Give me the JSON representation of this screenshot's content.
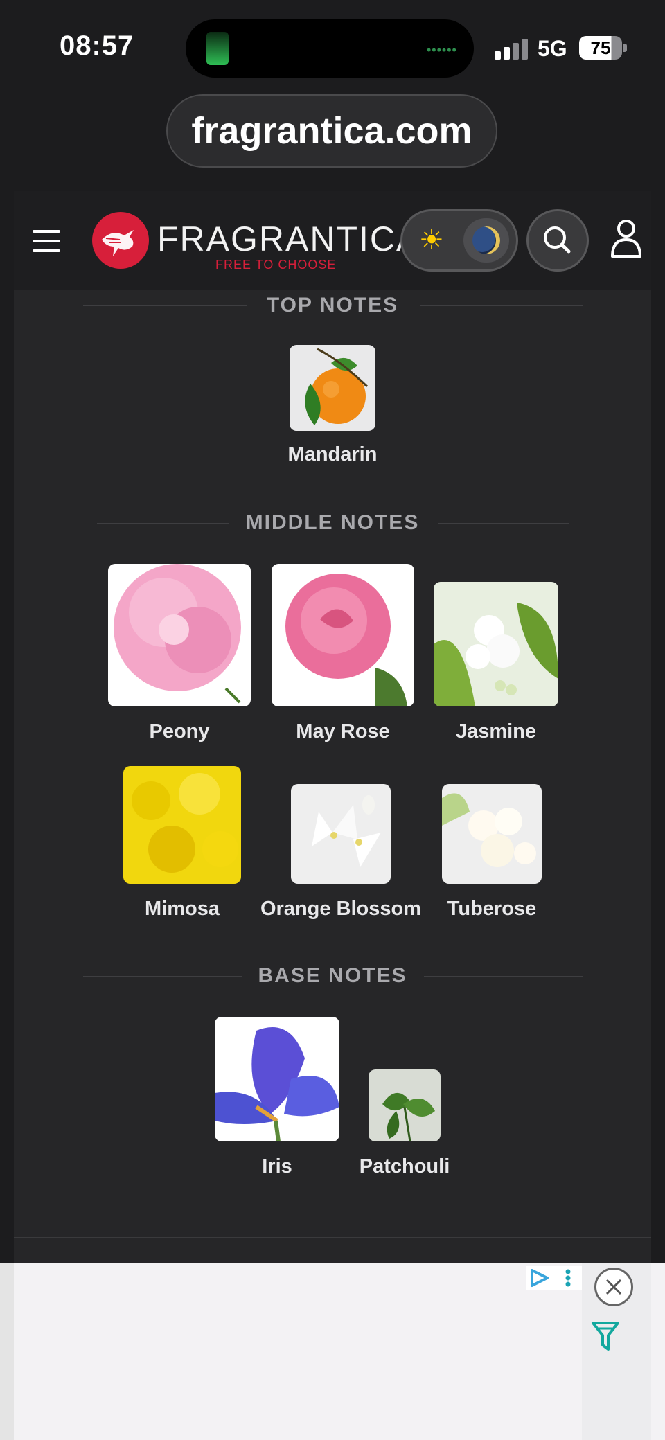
{
  "status_bar": {
    "time": "08:57",
    "network": "5G",
    "battery": "75"
  },
  "browser": {
    "url": "fragrantica.com"
  },
  "header": {
    "logo_name": "FRAGRANTICA",
    "logo_tagline": "FREE TO CHOOSE",
    "theme_toggle": "dark"
  },
  "pyramid": {
    "top": {
      "title": "TOP NOTES",
      "notes": [
        {
          "name": "Mandarin",
          "icon": "mandarin-orange"
        }
      ]
    },
    "middle": {
      "title": "MIDDLE NOTES",
      "notes": [
        {
          "name": "Peony",
          "icon": "pink-peony"
        },
        {
          "name": "May Rose",
          "icon": "pink-rose"
        },
        {
          "name": "Jasmine",
          "icon": "white-jasmine"
        },
        {
          "name": "Mimosa",
          "icon": "yellow-mimosa"
        },
        {
          "name": "Orange Blossom",
          "icon": "white-orange-blossom"
        },
        {
          "name": "Tuberose",
          "icon": "white-tuberose"
        }
      ]
    },
    "base": {
      "title": "BASE NOTES",
      "notes": [
        {
          "name": "Iris",
          "icon": "purple-iris"
        },
        {
          "name": "Patchouli",
          "icon": "green-patchouli-leaf"
        }
      ]
    }
  },
  "colors": {
    "brand": "#d71f3a",
    "page_bg": "#262628",
    "ad_bg": "#f3f2f4"
  }
}
